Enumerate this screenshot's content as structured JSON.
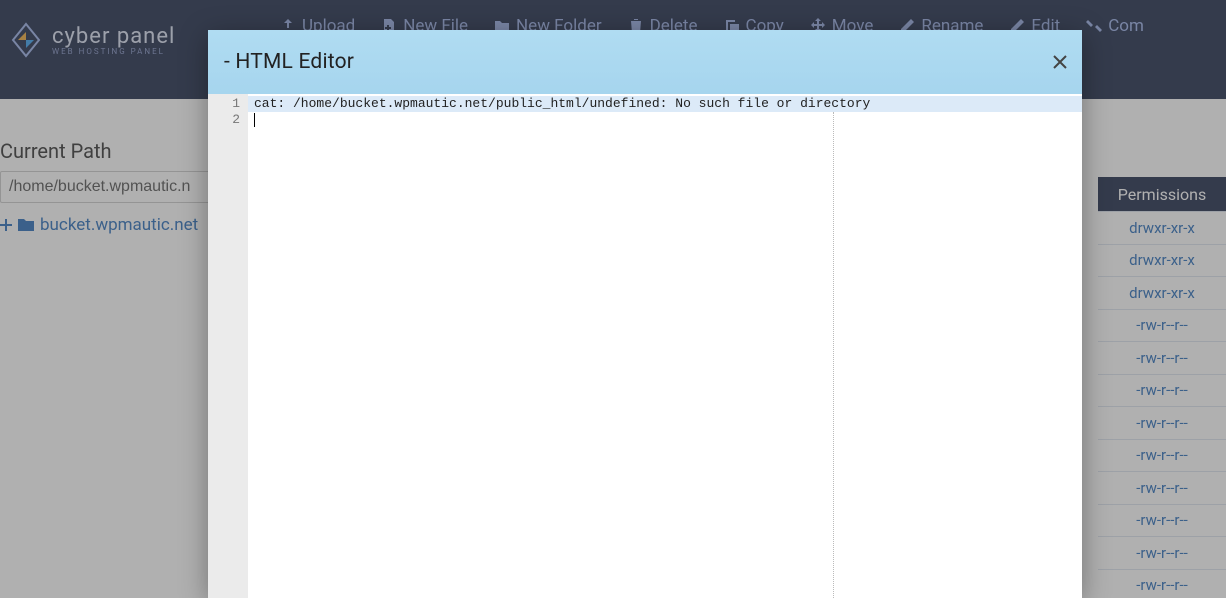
{
  "brand": {
    "name": "cyber panel",
    "tagline": "WEB HOSTING PANEL"
  },
  "toolbar": {
    "upload": "Upload",
    "new_file": "New File",
    "new_folder": "New Folder",
    "delete": "Delete",
    "copy": "Copy",
    "move": "Move",
    "rename": "Rename",
    "edit": "Edit",
    "compress": "Com"
  },
  "path": {
    "label": "Current Path",
    "value": "/home/bucket.wpmautic.n"
  },
  "tree": {
    "root": "bucket.wpmautic.net"
  },
  "permissions": {
    "header": "Permissions",
    "rows": [
      "drwxr-xr-x",
      "drwxr-xr-x",
      "drwxr-xr-x",
      "-rw-r--r--",
      "-rw-r--r--",
      "-rw-r--r--",
      "-rw-r--r--",
      "-rw-r--r--",
      "-rw-r--r--",
      "-rw-r--r--",
      "-rw-r--r--",
      "-rw-r--r--"
    ]
  },
  "modal": {
    "title": " - HTML Editor",
    "lines": [
      "cat: /home/bucket.wpmautic.net/public_html/undefined: No such file or directory",
      ""
    ],
    "gutter": [
      "1",
      "2"
    ]
  }
}
